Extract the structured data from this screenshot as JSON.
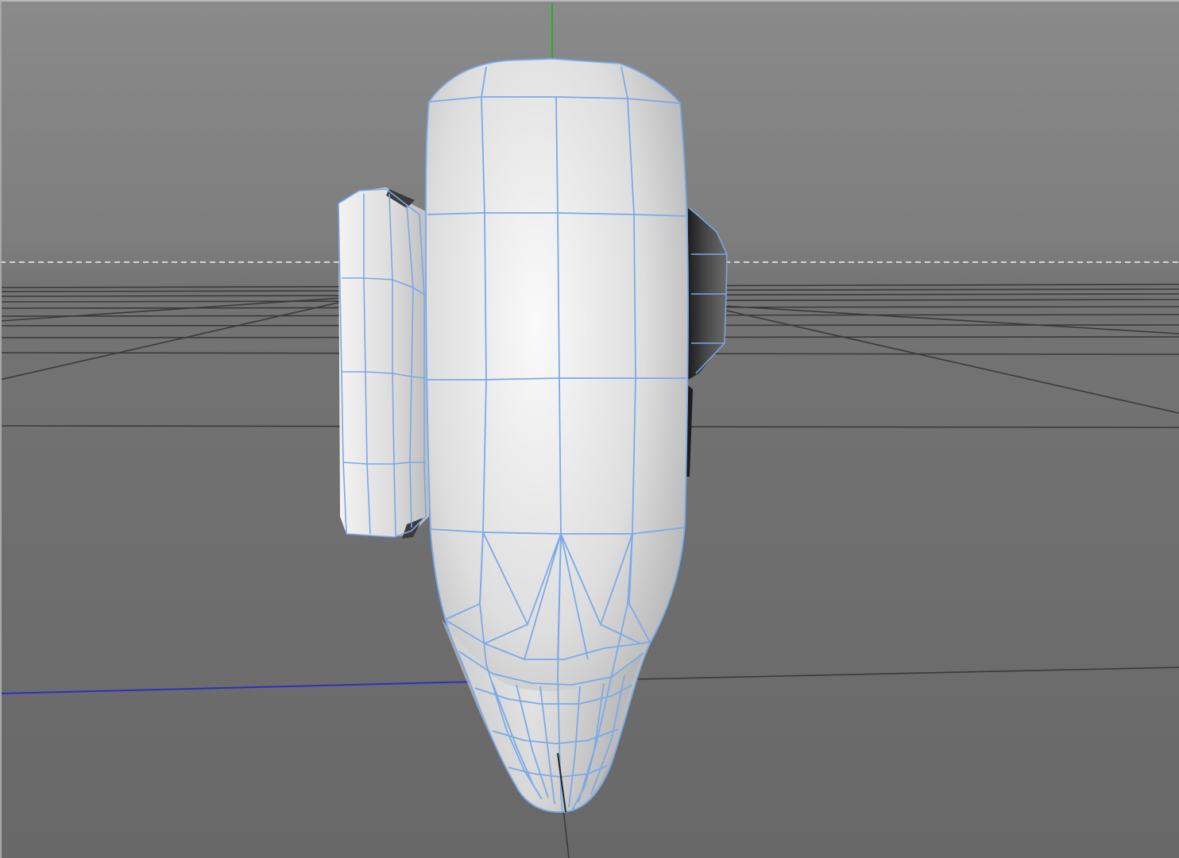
{
  "app": {
    "view": "3D viewport",
    "shading": "gouraud-shading-with-wireframe"
  },
  "colors": {
    "viewport_background": "#7c7c7c",
    "grid_line": "#3c3c3c",
    "horizon_dashes": "#cfcfcf",
    "axis_y": "#22b122",
    "axis_x": "#2d2dbd",
    "wireframe": "#78a8e8",
    "mesh_light": "#f4f4f4",
    "mesh_dark": "#9a9a9a",
    "dark_part": "#3a3a3a"
  },
  "scene": {
    "object": "selected-polygon-mesh",
    "axes_visible": [
      "y",
      "x"
    ],
    "grid_visible": true
  }
}
